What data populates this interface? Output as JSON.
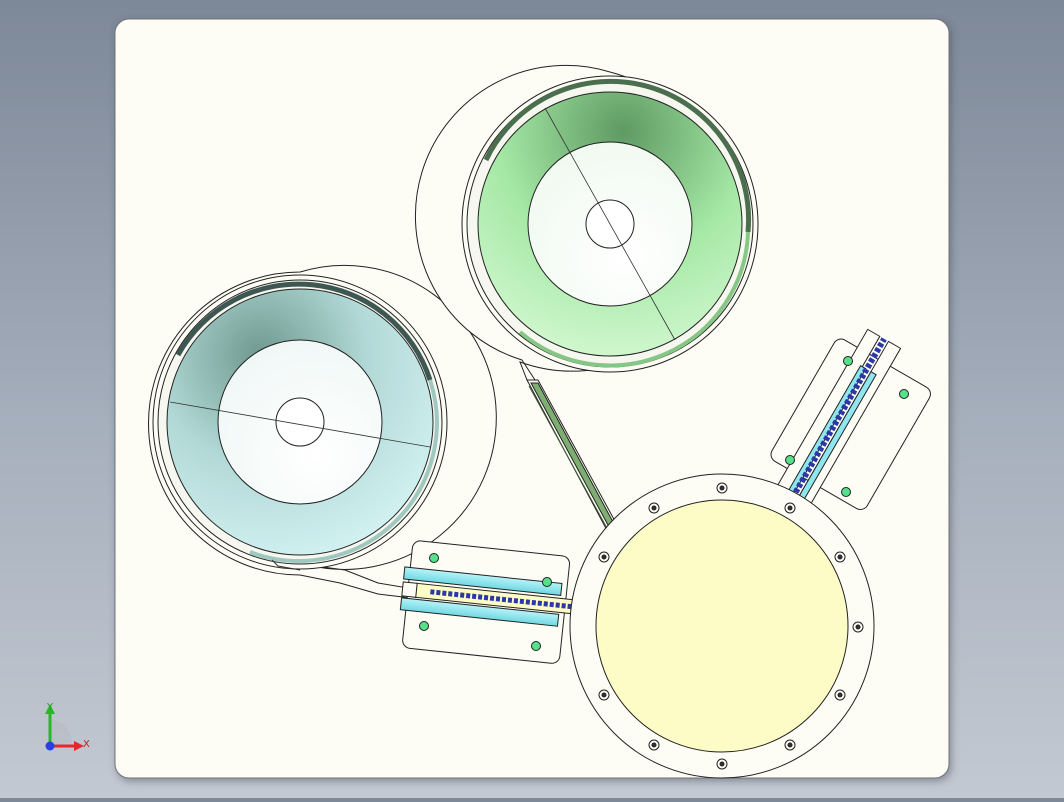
{
  "view": {
    "background_top": "#7d8898",
    "background_bottom": "#c3c9d2",
    "sheet_color": "#fdfdf5"
  },
  "triad": {
    "y_label": "Y",
    "x_label": "X",
    "y_color": "#2bb52b",
    "x_color": "#e12b2b",
    "z_color": "#2b3fe1"
  },
  "model": {
    "bowl_left_colors": [
      "#5f8d82",
      "#cfeff0"
    ],
    "bowl_right_colors": [
      "#4e8a57",
      "#cdf5cb"
    ],
    "disk_color": "#fdfcc6",
    "rail_color": "#8fe6ee",
    "chute_color": "#7fae72",
    "marker_color": "#d94fd6",
    "dot_color": "#57e08a"
  }
}
